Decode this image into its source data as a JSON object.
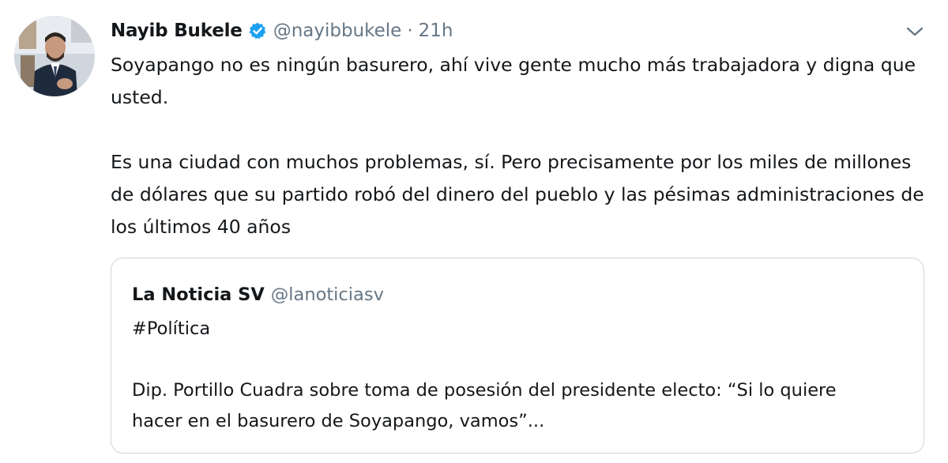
{
  "tweet": {
    "author": {
      "name": "Nayib Bukele",
      "handle": "@nayibbukele",
      "separator": "·",
      "time": "21h",
      "avatar_icon": "profile-photo-icon",
      "verified_icon": "verified-badge-icon"
    },
    "more_icon": "chevron-down-icon",
    "paragraphs": [
      "Soyapango no es ningún basurero, ahí vive gente mucho más trabajadora y digna que usted.",
      "Es una ciudad con muchos problemas, sí. Pero precisamente por los miles de millones de dólares que su partido robó del dinero del pueblo y las pésimas administraciones de los últimos 40 años"
    ]
  },
  "quoted_tweet": {
    "name": "La Noticia SV",
    "handle": "@lanoticiasv",
    "hashtag_line": "#Política",
    "text": "Dip. Portillo Cuadra sobre toma de posesión del presidente electo: “Si lo quiere hacer en el basurero de Soyapango, vamos”..."
  },
  "colors": {
    "text": "#14171a",
    "secondary": "#657786",
    "verified": "#1da1f2",
    "border": "#ccd6dd"
  }
}
